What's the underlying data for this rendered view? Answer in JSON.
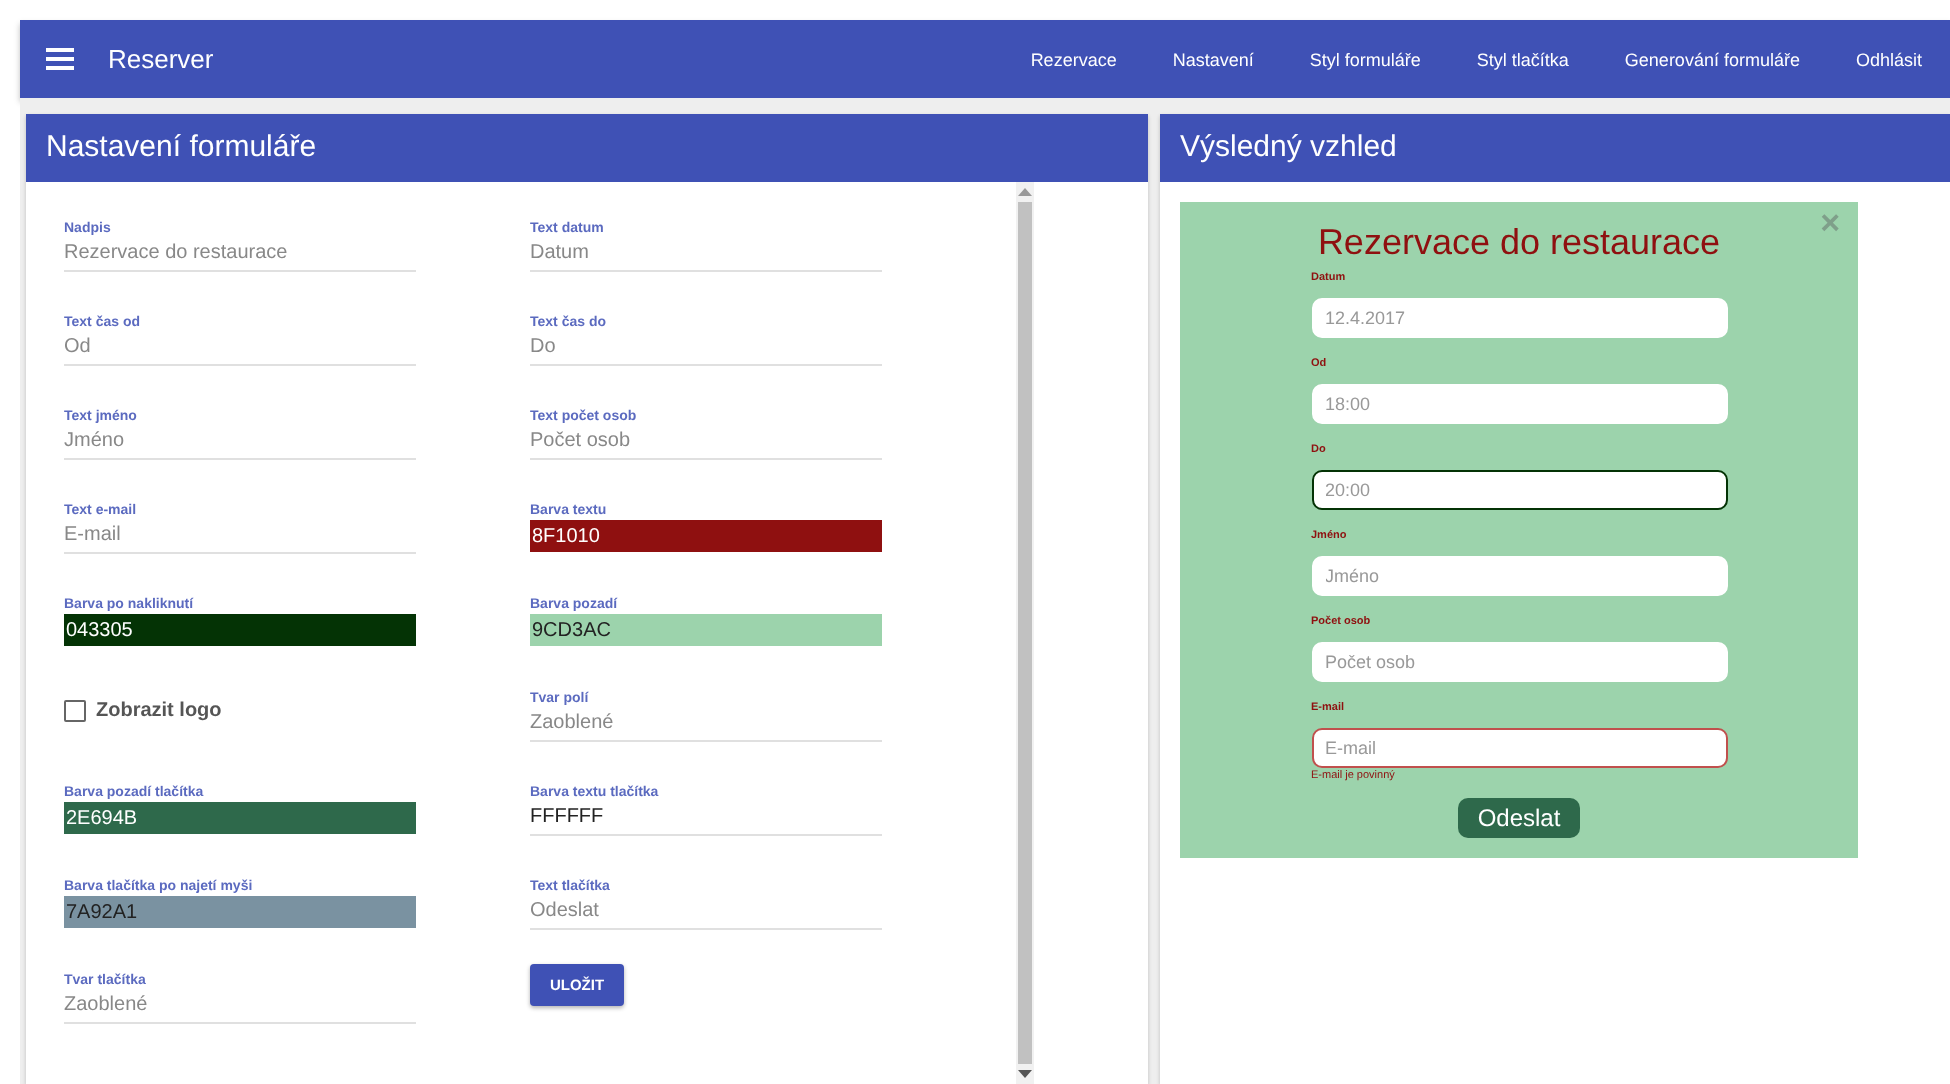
{
  "app_bar": {
    "title": "Reserver",
    "nav": [
      "Rezervace",
      "Nastavení",
      "Styl formuláře",
      "Styl tlačítka",
      "Generování formuláře",
      "Odhlásit"
    ]
  },
  "settings": {
    "title": "Nastavení formuláře",
    "fields": [
      {
        "kind": "text",
        "label": "Nadpis",
        "value": "Rezervace do restaurace"
      },
      {
        "kind": "text",
        "label": "Text datum",
        "value": "Datum"
      },
      {
        "kind": "text",
        "label": "Text čas od",
        "value": "Od"
      },
      {
        "kind": "text",
        "label": "Text čas do",
        "value": "Do"
      },
      {
        "kind": "text",
        "label": "Text jméno",
        "value": "Jméno"
      },
      {
        "kind": "text",
        "label": "Text počet osob",
        "value": "Počet osob"
      },
      {
        "kind": "text",
        "label": "Text e-mail",
        "value": "E-mail"
      },
      {
        "kind": "color",
        "label": "Barva textu",
        "value": "8F1010",
        "color": "#8f1010"
      },
      {
        "kind": "color",
        "label": "Barva po nakliknutí",
        "value": "043305",
        "color": "#043305"
      },
      {
        "kind": "color",
        "label": "Barva pozadí",
        "value": "9CD3AC",
        "color": "#9cd3ac"
      },
      {
        "kind": "checkbox",
        "label": "Zobrazit logo",
        "checked": false
      },
      {
        "kind": "text",
        "label": "Tvar polí",
        "value": "Zaoblené"
      },
      {
        "kind": "color",
        "label": "Barva pozadí tlačítka",
        "value": "2E694B",
        "color": "#2e694b"
      },
      {
        "kind": "text",
        "label": "Barva textu tlačítka",
        "value": "FFFFFF",
        "filled": true
      },
      {
        "kind": "color",
        "label": "Barva tlačítka po najetí myši",
        "value": "7A92A1",
        "color": "#7a92a1"
      },
      {
        "kind": "text",
        "label": "Text tlačítka",
        "value": "Odeslat"
      },
      {
        "kind": "text",
        "label": "Tvar tlačítka",
        "value": "Zaoblené"
      },
      {
        "kind": "button",
        "label": "ULOŽIT"
      }
    ]
  },
  "preview": {
    "title": "Výsledný vzhled",
    "close": "×",
    "heading": "Rezervace do restaurace",
    "fields": [
      {
        "label": "Datum",
        "value": "12.4.2017",
        "focused": false,
        "invalid": false
      },
      {
        "label": "Od",
        "value": "18:00",
        "focused": false,
        "invalid": false
      },
      {
        "label": "Do",
        "value": "20:00",
        "focused": true,
        "invalid": false
      },
      {
        "label": "Jméno",
        "placeholder": "Jméno",
        "focused": false,
        "invalid": false
      },
      {
        "label": "Počet osob",
        "placeholder": "Počet osob",
        "focused": false,
        "invalid": false
      },
      {
        "label": "E-mail",
        "placeholder": "E-mail",
        "focused": false,
        "invalid": true,
        "error": "E-mail je povinný"
      }
    ],
    "submit": "Odeslat"
  }
}
